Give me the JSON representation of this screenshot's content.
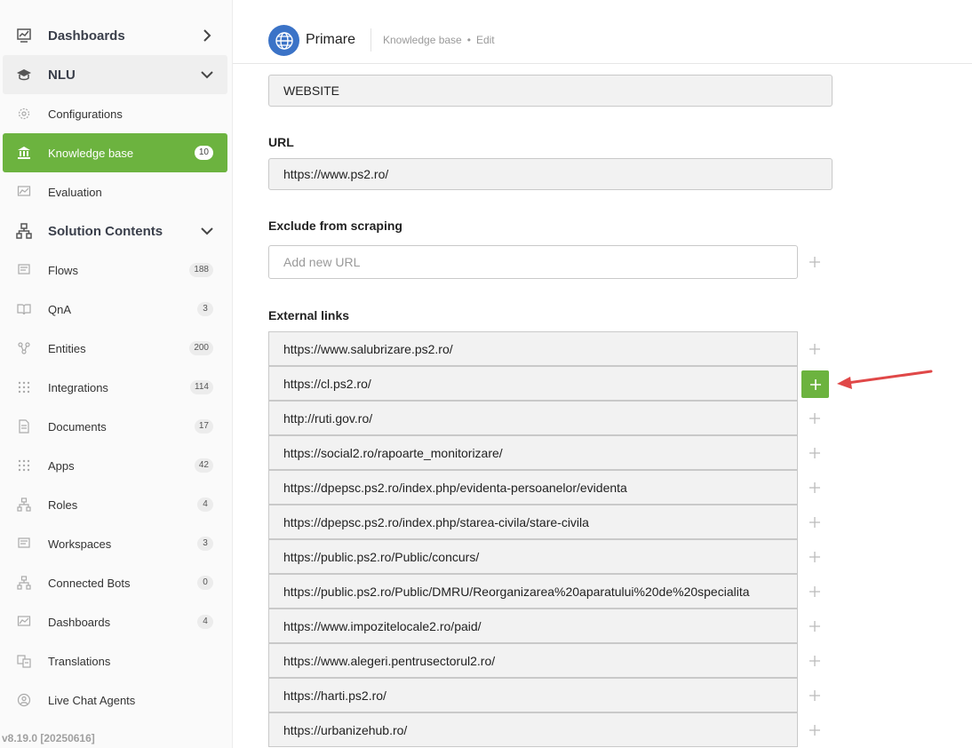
{
  "sidebar": {
    "items": [
      {
        "label": "Dashboards",
        "icon": "chart-icon"
      },
      {
        "label": "NLU",
        "icon": "graduation-cap-icon"
      },
      {
        "label": "Configurations",
        "icon": "gear-icon"
      },
      {
        "label": "Knowledge base",
        "icon": "bank-icon",
        "badge": "10"
      },
      {
        "label": "Evaluation",
        "icon": "chart-icon"
      },
      {
        "label": "Solution Contents",
        "icon": "sitemap-icon"
      },
      {
        "label": "Flows",
        "icon": "flows-icon",
        "badge": "188"
      },
      {
        "label": "QnA",
        "icon": "book-icon",
        "badge": "3"
      },
      {
        "label": "Entities",
        "icon": "entities-icon",
        "badge": "200"
      },
      {
        "label": "Integrations",
        "icon": "grid-icon",
        "badge": "114"
      },
      {
        "label": "Documents",
        "icon": "document-icon",
        "badge": "17"
      },
      {
        "label": "Apps",
        "icon": "grid-icon",
        "badge": "42"
      },
      {
        "label": "Roles",
        "icon": "sitemap-icon",
        "badge": "4"
      },
      {
        "label": "Workspaces",
        "icon": "workspace-icon",
        "badge": "3"
      },
      {
        "label": "Connected Bots",
        "icon": "sitemap-icon",
        "badge": "0"
      },
      {
        "label": "Dashboards",
        "icon": "chart-icon",
        "badge": "4"
      },
      {
        "label": "Translations",
        "icon": "translate-icon"
      },
      {
        "label": "Live Chat Agents",
        "icon": "agent-icon"
      }
    ],
    "version": "v8.19.0 [20250616]"
  },
  "header": {
    "app_name": "Primare",
    "crumb_section": "Knowledge base",
    "crumb_separator": "•",
    "crumb_page": "Edit"
  },
  "form": {
    "type_value": "WEBSITE",
    "url_label": "URL",
    "url_value": "https://www.ps2.ro/",
    "exclude_label": "Exclude from scraping",
    "exclude_placeholder": "Add new URL",
    "external_label": "External links",
    "external_links": [
      "https://www.salubrizare.ps2.ro/",
      "https://cl.ps2.ro/",
      "http://ruti.gov.ro/",
      "https://social2.ro/rapoarte_monitorizare/",
      "https://dpepsc.ps2.ro/index.php/evidenta-persoanelor/evidenta",
      "https://dpepsc.ps2.ro/index.php/starea-civila/stare-civila",
      "https://public.ps2.ro/Public/concurs/",
      "https://public.ps2.ro/Public/DMRU/Reorganizarea%20aparatului%20de%20specialita",
      "https://www.impozitelocale2.ro/paid/",
      "https://www.alegeri.pentrusectorul2.ro/",
      "https://harti.ps2.ro/",
      "https://urbanizehub.ro/"
    ],
    "plus_glyph": "+"
  },
  "colors": {
    "accent": "#6cb33f",
    "arrow": "#e04848",
    "globe": "#3b73c7"
  }
}
